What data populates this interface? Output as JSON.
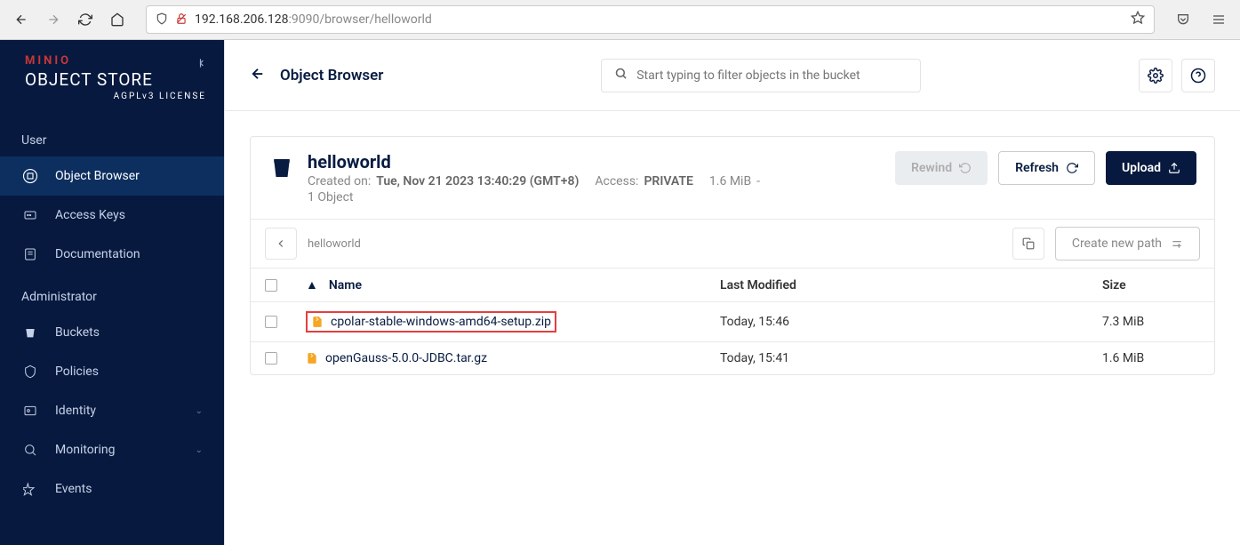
{
  "browser": {
    "url_host": "192.168.206.128",
    "url_path": ":9090/browser/helloworld"
  },
  "logo": {
    "line1": "MINIO",
    "line2": "OBJECT STORE",
    "line3": "AGPLv3 LICENSE"
  },
  "sidebar": {
    "section_user": "User",
    "section_admin": "Administrator",
    "items_user": [
      {
        "label": "Object Browser"
      },
      {
        "label": "Access Keys"
      },
      {
        "label": "Documentation"
      }
    ],
    "items_admin": [
      {
        "label": "Buckets"
      },
      {
        "label": "Policies"
      },
      {
        "label": "Identity"
      },
      {
        "label": "Monitoring"
      },
      {
        "label": "Events"
      }
    ]
  },
  "header": {
    "title": "Object Browser",
    "search_placeholder": "Start typing to filter objects in the bucket"
  },
  "bucket": {
    "name": "helloworld",
    "created_label": "Created on:",
    "created_value": "Tue, Nov 21 2023 13:40:29 (GMT+8)",
    "access_label": "Access:",
    "access_value": "PRIVATE",
    "size": "1.6 MiB",
    "size_dash": "-",
    "object_count": "1 Object",
    "rewind": "Rewind",
    "refresh": "Refresh",
    "upload": "Upload"
  },
  "breadcrumb": {
    "path": "helloworld",
    "newpath": "Create new path"
  },
  "table": {
    "headers": {
      "name": "Name",
      "modified": "Last Modified",
      "size": "Size"
    },
    "rows": [
      {
        "name": "cpolar-stable-windows-amd64-setup.zip",
        "modified": "Today, 15:46",
        "size": "7.3 MiB",
        "highlight": true
      },
      {
        "name": "openGauss-5.0.0-JDBC.tar.gz",
        "modified": "Today, 15:41",
        "size": "1.6 MiB",
        "highlight": false
      }
    ]
  }
}
